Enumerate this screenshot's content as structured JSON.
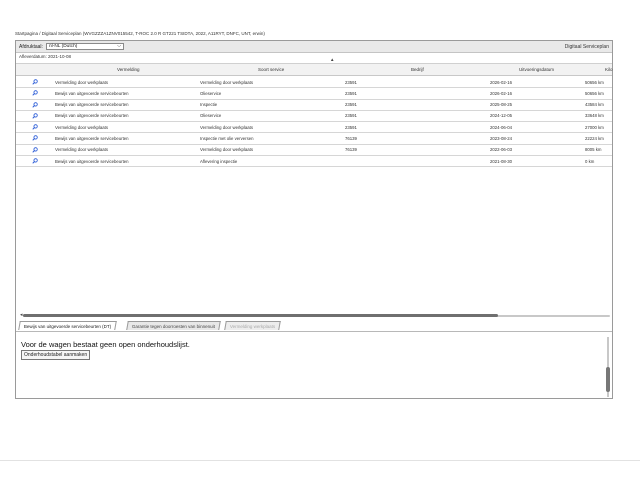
{
  "breadcrumb": "Startpagina / Digitaal Serviceplan (WVGZZZA1ZNV015542, T-ROC 2.0 R GT221 TSIDTA, 2022, A11RYT, DNFC, UNT, erwin)",
  "toolbar": {
    "print_label": "Afdruktaal:",
    "language": "nl-NL (Dutch)",
    "app_title": "Digitaal Serviceplan"
  },
  "delivery_date": "Afleverdatum: 2021-10-08",
  "scroll_marker": "▲",
  "table": {
    "columns": [
      "Vermelding",
      "Soort service",
      "Bedrijf",
      "Uitvoeringsdatum",
      "Kilo"
    ],
    "rows": [
      {
        "vermelding": "Vermelding door werkplaats",
        "soort": "Vermelding door werkplaats",
        "bedrijf": "23591",
        "datum": "2026-02-16",
        "km": "50656 km"
      },
      {
        "vermelding": "Bewijs van uitgevoerde servicebeurten",
        "soort": "Olieservice",
        "bedrijf": "23591",
        "datum": "2026-02-16",
        "km": "50656 km"
      },
      {
        "vermelding": "Bewijs van uitgevoerde servicebeurten",
        "soort": "Inspectie",
        "bedrijf": "23591",
        "datum": "2025-08-25",
        "km": "43584 km"
      },
      {
        "vermelding": "Bewijs van uitgevoerde servicebeurten",
        "soort": "Olieservice",
        "bedrijf": "23591",
        "datum": "2024-12-05",
        "km": "33648 km"
      },
      {
        "vermelding": "Vermelding door werkplaats",
        "soort": "Vermelding door werkplaats",
        "bedrijf": "23591",
        "datum": "2024-06-04",
        "km": "27000 km"
      },
      {
        "vermelding": "Bewijs van uitgevoerde servicebeurten",
        "soort": "Inspectie met olie verversen",
        "bedrijf": "76139",
        "datum": "2023-08-24",
        "km": "22224 km"
      },
      {
        "vermelding": "Vermelding door werkplaats",
        "soort": "Vermelding door werkplaats",
        "bedrijf": "76139",
        "datum": "2022-06-03",
        "km": "8005 km"
      },
      {
        "vermelding": "Bewijs van uitgevoerde servicebeurten",
        "soort": "Aflevering inspectie",
        "bedrijf": "",
        "datum": "2021-08-30",
        "km": "0 km"
      }
    ]
  },
  "tabs": [
    {
      "label": "Bewijs van uitgevoerde servicebeurten (DT)",
      "state": "active"
    },
    {
      "label": "Garantie tegen doorroesten van binnenuit",
      "state": "inactive"
    },
    {
      "label": "Vermelding werkplaats",
      "state": "disabled"
    }
  ],
  "panel": {
    "message": "Voor de wagen bestaat geen open onderhoudslijst.",
    "create_button": "Onderhoudstabel aanmaken"
  },
  "icons": {
    "row_detail": "magnifier-icon",
    "dropdown": "chevron-down-icon",
    "accent": "#2a5bd7"
  }
}
